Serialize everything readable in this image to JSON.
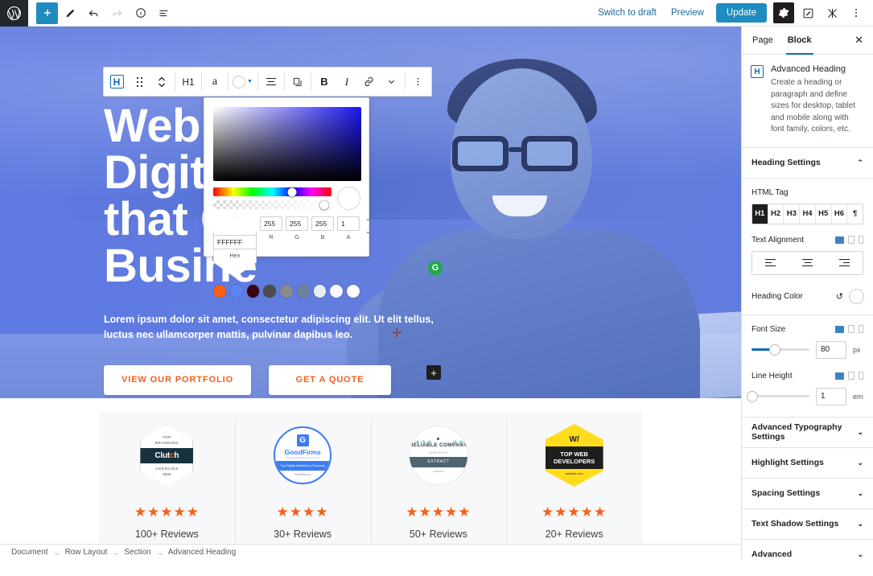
{
  "topbar": {
    "logo_icon": "wordpress-logo",
    "left_tools": [
      {
        "name": "add-block-button",
        "icon": "plus-icon",
        "label": "+"
      },
      {
        "name": "tools-button",
        "icon": "pencil-icon",
        "label": "✎"
      },
      {
        "name": "undo-button",
        "icon": "undo-icon",
        "label": "↶"
      },
      {
        "name": "redo-button",
        "icon": "redo-icon",
        "label": "↷"
      },
      {
        "name": "details-button",
        "icon": "info-icon",
        "label": "ⓘ"
      },
      {
        "name": "list-view-button",
        "icon": "list-view-icon",
        "label": "☰"
      }
    ],
    "switch_to_draft": "Switch to draft",
    "preview": "Preview",
    "update": "Update",
    "settings_icon": "gear-icon",
    "pencil_box_icon": "edit-box-icon",
    "plugin_icon": "plugin-icon",
    "more_icon": "kebab-menu-icon"
  },
  "block_toolbar": {
    "block_type_icon": "heading-block-icon",
    "block_type_label": "H",
    "drag_icon": "drag-handle-icon",
    "mover_icon": "move-up-down-icon",
    "heading_level": "H1",
    "typography_label": "a",
    "color_label": "color-swatch",
    "align_icon": "align-icon",
    "duplicate_icon": "copy-icon",
    "bold": "B",
    "italic": "I",
    "link_icon": "link-icon",
    "chevron": "⌄",
    "more_icon": "kebab-menu-icon"
  },
  "color_picker": {
    "hex_value": "FFFFFF",
    "hex_label": "Hex",
    "r_value": "255",
    "g_value": "255",
    "b_value": "255",
    "a_value": "1",
    "r_label": "R",
    "g_label": "G",
    "b_label": "B",
    "a_label": "A",
    "hue_position_pct": 67,
    "alpha_position_pct": 94,
    "preview_color": "#FFFFFF",
    "swatches": [
      "#f4601a",
      "#5b84f0",
      "#380511",
      "#4d4d4d",
      "#8c8c8c",
      "#6c819b",
      "#e9eef3",
      "#f7f9fa",
      "#ffffff"
    ]
  },
  "hero": {
    "heading": "Web D\nDigital ...ng\nthat G...r\nBusine",
    "heading_line1": "Web D",
    "heading_line2": "Digital",
    "heading_line3": "that G",
    "heading_line4": "Busine",
    "paragraph": "Lorem ipsum dolor sit amet, consectetur adipiscing elit. Ut elit tellus, luctus nec ullamcorper mattis, pulvinar dapibus leo.",
    "cta_primary": "VIEW OUR PORTFOLIO",
    "cta_secondary": "GET A QUOTE",
    "accent_color": "#f4601a",
    "overlay_color": "#5c78dd",
    "green_badge_label": "G",
    "inserter_label": "+"
  },
  "awards": [
    {
      "badge_type": "clutch",
      "badge_top": "TOP",
      "badge_sub": "BRANDING",
      "badge_name_a": "Clut",
      "badge_name_accent": "c",
      "badge_name_b": "h",
      "badge_line3": "AGENCIES",
      "badge_year": "2020",
      "stars": 5,
      "reviews": "100+ Reviews"
    },
    {
      "badge_type": "goodfirms",
      "badge_mark": "G",
      "badge_name": "GoodFirms",
      "badge_sub": "Research Based Reviews Firm",
      "badge_ribbon": "Top Digital Marketing Company",
      "badge_foot": "GoodFirms.co",
      "stars": 4,
      "reviews": "30+ Reviews"
    },
    {
      "badge_type": "reliable",
      "badge_title": "RELIABLE COMPANY",
      "badge_sub": "VERIFIED BY",
      "badge_band": "EXTRACT",
      "badge_foot": "extract.co",
      "stars": 5,
      "reviews": "50+ Reviews"
    },
    {
      "badge_type": "wadline",
      "badge_mark": "W/",
      "badge_band": "TOP WEB DEVELOPERS",
      "badge_foot": "wadline.com",
      "stars": 5,
      "reviews": "20+ Reviews"
    }
  ],
  "sidebar": {
    "tab_page": "Page",
    "tab_block": "Block",
    "close_icon": "close-icon",
    "block_icon_label": "H",
    "block_title": "Advanced Heading",
    "block_description": "Create a heading or paragraph and define sizes for desktop, tablet and mobile along with font family, colors, etc.",
    "heading_settings": "Heading Settings",
    "html_tag_label": "HTML Tag",
    "html_tags": [
      "H1",
      "H2",
      "H3",
      "H4",
      "H5",
      "H6",
      "¶"
    ],
    "html_tag_active": "H1",
    "text_alignment_label": "Text Alignment",
    "heading_color_label": "Heading Color",
    "heading_color_value": "#FFFFFF",
    "font_size_label": "Font Size",
    "font_size_value": "80",
    "font_size_unit": "px",
    "font_size_pct": 40,
    "line_height_label": "Line Height",
    "line_height_value": "1",
    "line_height_unit": "em",
    "line_height_pct": 2,
    "panels": [
      "Advanced Typography Settings",
      "Highlight Settings",
      "Spacing Settings",
      "Text Shadow Settings",
      "Advanced"
    ]
  },
  "breadcrumb": [
    "Document",
    "Row Layout",
    "Section",
    "Advanced Heading"
  ]
}
